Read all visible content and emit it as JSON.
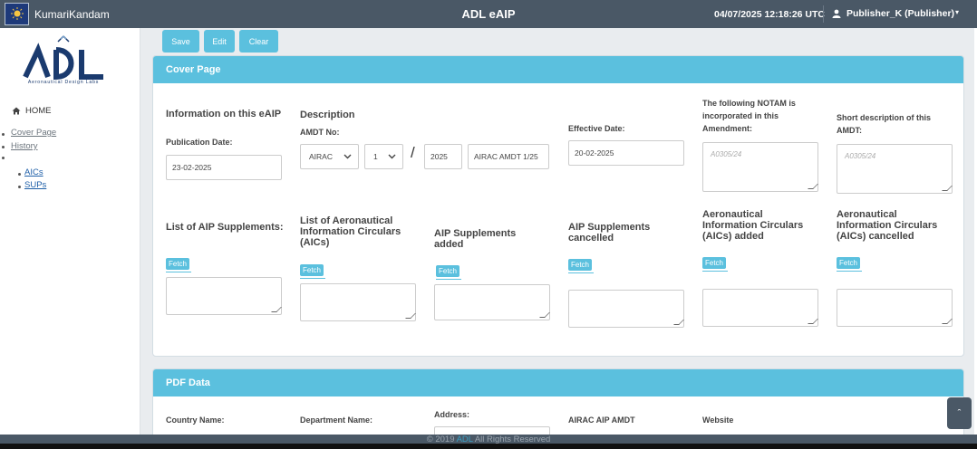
{
  "header": {
    "brand_name": "KumariKandam",
    "app_title": "ADL eAIP",
    "datetime": "04/07/2025 12:18:26 UTC",
    "user": "Publisher_K (Publisher)",
    "user_caret": "▾"
  },
  "sidebar": {
    "logo_text": "ADL",
    "logo_subtitle": "Aeronautical Design Labs",
    "home_label": "HOME",
    "links": [
      "Cover Page",
      "History"
    ],
    "sub_links": [
      "AICs",
      "SUPs"
    ]
  },
  "toolbar": {
    "save": "Save",
    "edit": "Edit",
    "clear": "Clear"
  },
  "cover_page": {
    "title": "Cover Page",
    "info_heading": "Information on this eAIP",
    "publication_date_label": "Publication Date:",
    "publication_date": "23-02-2025",
    "description_heading": "Description",
    "amdt_no_label": "AMDT No:",
    "amdt_type": "AIRAC",
    "amdt_number": "1",
    "amdt_slash": "/",
    "amdt_year": "2025",
    "amdt_name": "AIRAC AMDT 1/25",
    "effective_date_label": "Effective Date:",
    "effective_date": "20-02-2025",
    "notam_label": "The following NOTAM is incorporated in this Amendment:",
    "notam_placeholder": "A0305/24",
    "short_desc_label": "Short description of this AMDT:",
    "short_desc_placeholder": "A0305/24",
    "fetch_label": "Fetch",
    "row2": [
      "List of AIP Supplements:",
      "List of Aeronautical Information Circulars (AICs)",
      "AIP Supplements added",
      "AIP Supplements cancelled",
      "Aeronautical Information Circulars (AICs) added",
      "Aeronautical Information Circulars (AICs) cancelled"
    ]
  },
  "pdf_data": {
    "title": "PDF Data",
    "fields": [
      "Country Name:",
      "Department Name:",
      "Address:",
      "AIRAC AIP AMDT",
      "Website"
    ]
  },
  "footer": {
    "prefix": "© 2019 ",
    "brand": "ADL",
    "suffix": " All Rights Reserved"
  },
  "scroll_top_glyph": "ˆ",
  "colors": {
    "header_bg": "#4a5866",
    "accent": "#5bc0de",
    "logo_blue": "#1a3a6e"
  }
}
